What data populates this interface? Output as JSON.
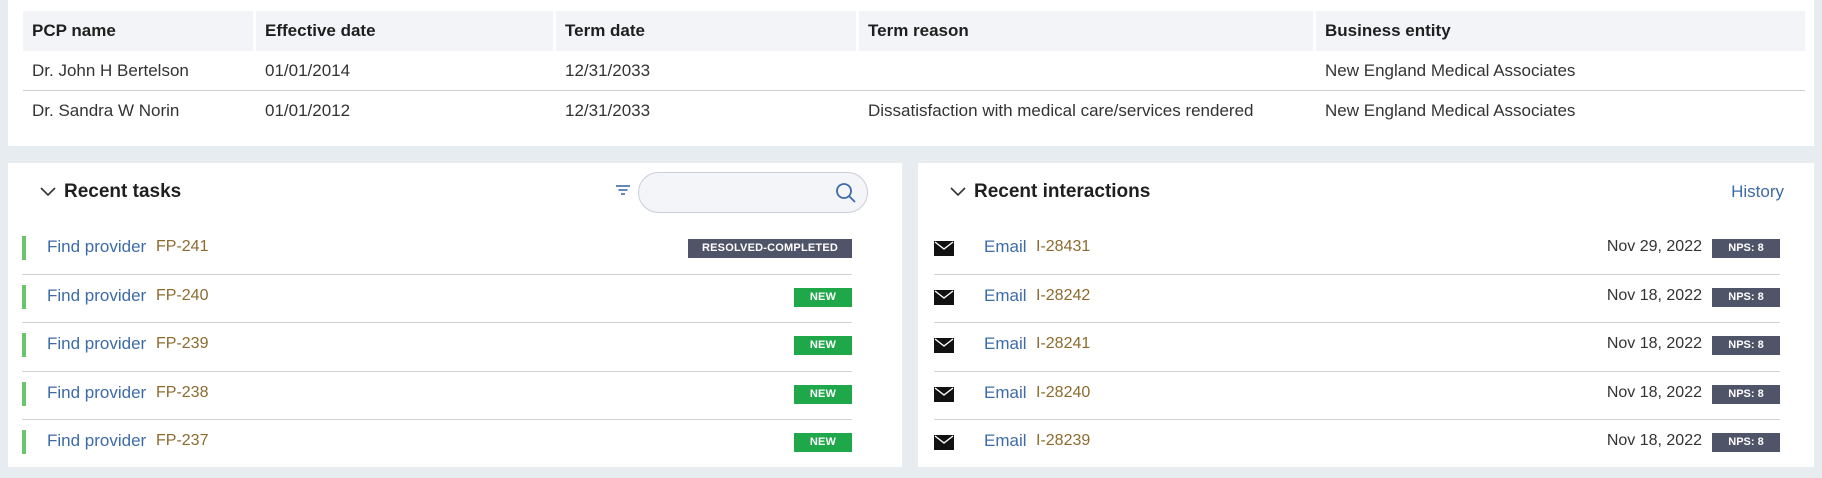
{
  "pcp_table": {
    "headers": [
      "PCP name",
      "Effective date",
      "Term date",
      "Term reason",
      "Business entity"
    ],
    "rows": [
      [
        "Dr. John H Bertelson",
        "01/01/2014",
        "12/31/2033",
        "",
        "New England Medical Associates"
      ],
      [
        "Dr. Sandra W Norin",
        "01/01/2012",
        "12/31/2033",
        "Dissatisfaction with medical care/services rendered",
        "New England Medical Associates"
      ]
    ]
  },
  "recent_tasks": {
    "title": "Recent tasks",
    "search_placeholder": "",
    "items": [
      {
        "label": "Find provider",
        "id": "FP-241",
        "status": "RESOLVED-COMPLETED"
      },
      {
        "label": "Find provider",
        "id": "FP-240",
        "status": "NEW"
      },
      {
        "label": "Find provider",
        "id": "FP-239",
        "status": "NEW"
      },
      {
        "label": "Find provider",
        "id": "FP-238",
        "status": "NEW"
      },
      {
        "label": "Find provider",
        "id": "FP-237",
        "status": "NEW"
      }
    ]
  },
  "recent_interactions": {
    "title": "Recent interactions",
    "history_label": "History",
    "items": [
      {
        "type": "Email",
        "id": "I-28431",
        "date": "Nov 29, 2022",
        "nps": "NPS: 8"
      },
      {
        "type": "Email",
        "id": "I-28242",
        "date": "Nov 18, 2022",
        "nps": "NPS: 8"
      },
      {
        "type": "Email",
        "id": "I-28241",
        "date": "Nov 18, 2022",
        "nps": "NPS: 8"
      },
      {
        "type": "Email",
        "id": "I-28240",
        "date": "Nov 18, 2022",
        "nps": "NPS: 8"
      },
      {
        "type": "Email",
        "id": "I-28239",
        "date": "Nov 18, 2022",
        "nps": "NPS: 8"
      }
    ]
  },
  "colors": {
    "link": "#3d6ba8",
    "reference": "#8c6a2e",
    "badge_new": "#1fa84a",
    "badge_dark": "#4f5468",
    "accent": "#6cc46a"
  }
}
